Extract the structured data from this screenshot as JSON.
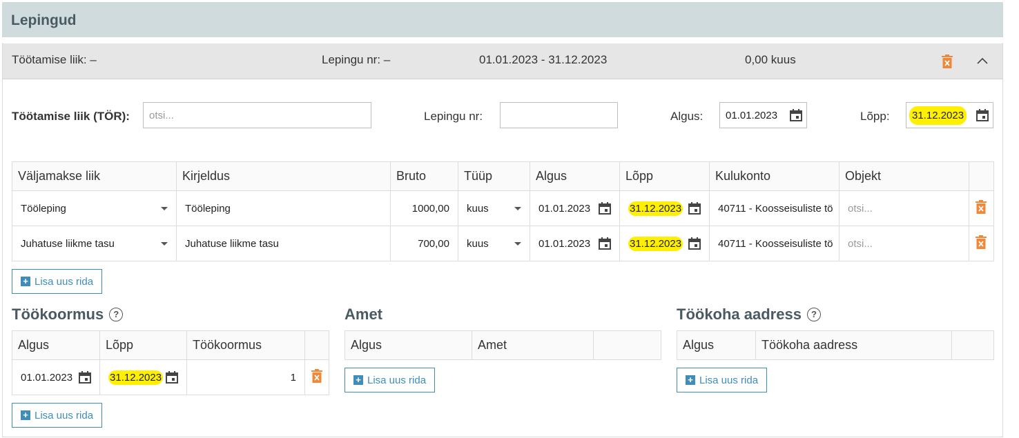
{
  "header": {
    "title": "Lepingud"
  },
  "summary": {
    "employment_type": "Töötamise liik: –",
    "contract_no": "Lepingu nr: –",
    "period": "01.01.2023 - 31.12.2023",
    "amount": "0,00 kuus"
  },
  "form": {
    "type_label": "Töötamise liik (TÖR):",
    "type_placeholder": "otsi...",
    "contract_label": "Lepingu nr:",
    "contract_value": "",
    "start_label": "Algus:",
    "start_value": "01.01.2023",
    "end_label": "Lõpp:",
    "end_value": "31.12.2023"
  },
  "payments": {
    "headers": [
      "Väljamakse liik",
      "Kirjeldus",
      "Bruto",
      "Tüüp",
      "Algus",
      "Lõpp",
      "Kulukonto",
      "Objekt",
      ""
    ],
    "rows": [
      {
        "kind": "Tööleping",
        "desc": "Tööleping",
        "gross": "1000,00",
        "type": "kuus",
        "start": "01.01.2023",
        "end": "31.12.2023",
        "account": "40711 - Koosseisuliste tö",
        "object": "otsi..."
      },
      {
        "kind": "Juhatuse liikme tasu",
        "desc": "Juhatuse liikme tasu",
        "gross": "700,00",
        "type": "kuus",
        "start": "01.01.2023",
        "end": "31.12.2023",
        "account": "40711 - Koosseisuliste tö",
        "object": "otsi..."
      }
    ],
    "add_label": "Lisa uus rida"
  },
  "workload": {
    "title": "Töökoormus",
    "headers": [
      "Algus",
      "Lõpp",
      "Töökoormus",
      ""
    ],
    "rows": [
      {
        "start": "01.01.2023",
        "end": "31.12.2023",
        "load": "1"
      }
    ],
    "add_label": "Lisa uus rida"
  },
  "position": {
    "title": "Amet",
    "headers": [
      "Algus",
      "Amet",
      ""
    ],
    "add_label": "Lisa uus rida"
  },
  "address": {
    "title": "Töökoha aadress",
    "headers": [
      "Algus",
      "Töökoha aadress",
      ""
    ],
    "add_label": "Lisa uus rida"
  },
  "colors": {
    "accent": "#3e8eb7",
    "danger": "#f0883a",
    "highlight": "#ffef00",
    "title_bar": "#cfdbdc"
  },
  "icons": [
    "calendar-icon",
    "trash-icon",
    "chevron-up-icon",
    "help-icon",
    "plus-icon",
    "caret-down-icon"
  ]
}
